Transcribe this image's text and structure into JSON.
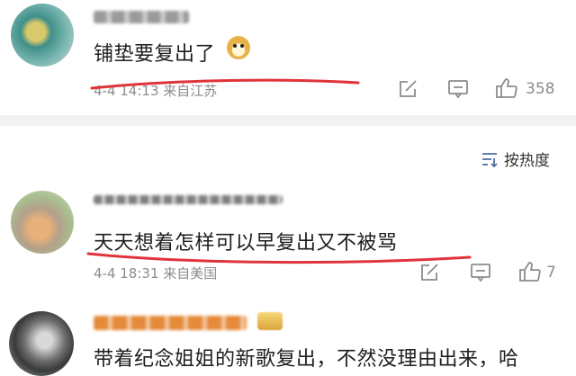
{
  "comments": [
    {
      "text": "铺垫要复出了",
      "emoji": "doge-emoji",
      "meta": "4-4 14:13 来自江苏",
      "likes": "358"
    },
    {
      "text": "天天想着怎样可以早复出又不被骂",
      "meta": "4-4 18:31 来自美国",
      "likes": "7"
    },
    {
      "text": "带着纪念姐姐的新歌复出，不然没理由出来，哈"
    }
  ],
  "sort": {
    "label": "按热度"
  },
  "colors": {
    "annotation": "#e0333a",
    "divider": "#f2f2f2",
    "meta_text": "#8c8c8c"
  }
}
